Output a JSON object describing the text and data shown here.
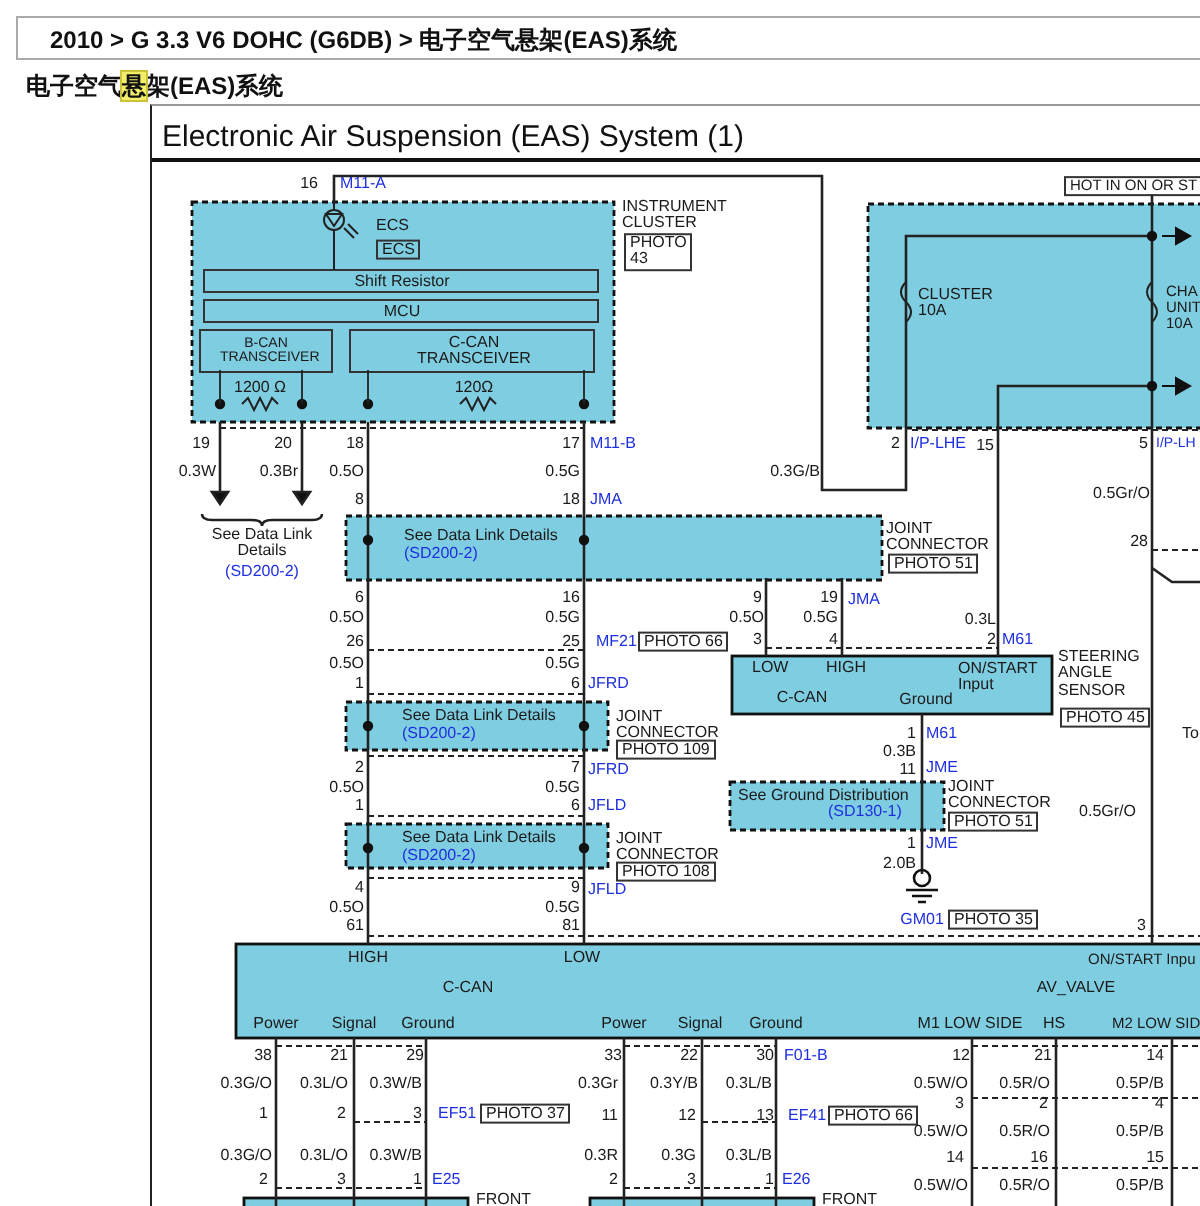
{
  "breadcrumb": "2010 > G 3.3 V6 DOHC (G6DB) > 电子空气悬架(EAS)系统",
  "heading": {
    "before": "电子空气",
    "highlighted": "悬",
    "after": "架(EAS)系统"
  },
  "diagram": {
    "title": "Electronic Air Suspension (EAS) System (1)",
    "labels": [
      {
        "text": "16",
        "kind": "pin"
      },
      {
        "text": "M11-A",
        "kind": "conn"
      },
      {
        "text": "ECS",
        "kind": "label"
      },
      {
        "text": "ECS",
        "kind": "tag"
      },
      {
        "text": "INSTRUMENT CLUSTER",
        "kind": "label"
      },
      {
        "text": "PHOTO 43",
        "kind": "photo"
      },
      {
        "text": "Shift Resistor",
        "kind": "bar"
      },
      {
        "text": "MCU",
        "kind": "bar"
      },
      {
        "text": "B-CAN TRANSCEIVER",
        "kind": "bar"
      },
      {
        "text": "C-CAN TRANSCEIVER",
        "kind": "bar"
      },
      {
        "text": "1200 Ω",
        "kind": "label"
      },
      {
        "text": "120Ω",
        "kind": "label"
      },
      {
        "text": "19",
        "kind": "pin"
      },
      {
        "text": "20",
        "kind": "pin"
      },
      {
        "text": "18",
        "kind": "pin"
      },
      {
        "text": "17",
        "kind": "pin"
      },
      {
        "text": "M11-B",
        "kind": "conn"
      },
      {
        "text": "0.3W",
        "kind": "wire"
      },
      {
        "text": "0.3Br",
        "kind": "wire"
      },
      {
        "text": "0.5O",
        "kind": "wire"
      },
      {
        "text": "0.5G",
        "kind": "wire"
      },
      {
        "text": "0.3G/B",
        "kind": "wire"
      },
      {
        "text": "8",
        "kind": "pin"
      },
      {
        "text": "18",
        "kind": "pin"
      },
      {
        "text": "JMA",
        "kind": "conn"
      },
      {
        "text": "See Data Link Details",
        "kind": "label"
      },
      {
        "text": "(SD200-2)",
        "kind": "link"
      },
      {
        "text": "See Data Link Details",
        "kind": "label"
      },
      {
        "text": "(SD200-2)",
        "kind": "link"
      },
      {
        "text": "JOINT CONNECTOR",
        "kind": "label"
      },
      {
        "text": "PHOTO 51",
        "kind": "photo"
      },
      {
        "text": "HOT IN ON OR ST",
        "kind": "tag"
      },
      {
        "text": "CLUSTER 10A",
        "kind": "label"
      },
      {
        "text": "CHA UNIT 10A",
        "kind": "label"
      },
      {
        "text": "2",
        "kind": "pin"
      },
      {
        "text": "I/P-LHE",
        "kind": "conn"
      },
      {
        "text": "15",
        "kind": "pin"
      },
      {
        "text": "5",
        "kind": "pin"
      },
      {
        "text": "I/P-LH",
        "kind": "conn"
      },
      {
        "text": "0.5Gr/O",
        "kind": "wire"
      },
      {
        "text": "28",
        "kind": "pin"
      },
      {
        "text": "6",
        "kind": "pin"
      },
      {
        "text": "16",
        "kind": "pin"
      },
      {
        "text": "9",
        "kind": "pin"
      },
      {
        "text": "19",
        "kind": "pin"
      },
      {
        "text": "JMA",
        "kind": "conn"
      },
      {
        "text": "0.5O",
        "kind": "wire"
      },
      {
        "text": "0.5G",
        "kind": "wire"
      },
      {
        "text": "0.5O",
        "kind": "wire"
      },
      {
        "text": "0.5G",
        "kind": "wire"
      },
      {
        "text": "0.3L",
        "kind": "wire"
      },
      {
        "text": "26",
        "kind": "pin"
      },
      {
        "text": "25",
        "kind": "pin"
      },
      {
        "text": "MF21",
        "kind": "conn"
      },
      {
        "text": "PHOTO 66",
        "kind": "photo"
      },
      {
        "text": "3",
        "kind": "pin"
      },
      {
        "text": "4",
        "kind": "pin"
      },
      {
        "text": "2",
        "kind": "pin"
      },
      {
        "text": "M61",
        "kind": "conn"
      },
      {
        "text": "0.5O",
        "kind": "wire"
      },
      {
        "text": "0.5G",
        "kind": "wire"
      },
      {
        "text": "1",
        "kind": "pin"
      },
      {
        "text": "6",
        "kind": "pin"
      },
      {
        "text": "JFRD",
        "kind": "conn"
      },
      {
        "text": "LOW",
        "kind": "label"
      },
      {
        "text": "HIGH",
        "kind": "label"
      },
      {
        "text": "C-CAN",
        "kind": "label"
      },
      {
        "text": "ON/START Input",
        "kind": "label"
      },
      {
        "text": "Ground",
        "kind": "label"
      },
      {
        "text": "See Data Link Details",
        "kind": "label"
      },
      {
        "text": "(SD200-2)",
        "kind": "link"
      },
      {
        "text": "JOINT CONNECTOR",
        "kind": "label"
      },
      {
        "text": "PHOTO 109",
        "kind": "photo"
      },
      {
        "text": "STEERING ANGLE SENSOR",
        "kind": "label"
      },
      {
        "text": "PHOTO 45",
        "kind": "photo"
      },
      {
        "text": "1",
        "kind": "pin"
      },
      {
        "text": "M61",
        "kind": "conn"
      },
      {
        "text": "0.3B",
        "kind": "wire"
      },
      {
        "text": "11",
        "kind": "pin"
      },
      {
        "text": "JME",
        "kind": "conn"
      },
      {
        "text": "To",
        "kind": "label"
      },
      {
        "text": "2",
        "kind": "pin"
      },
      {
        "text": "7",
        "kind": "pin"
      },
      {
        "text": "JFRD",
        "kind": "conn"
      },
      {
        "text": "0.5O",
        "kind": "wire"
      },
      {
        "text": "0.5G",
        "kind": "wire"
      },
      {
        "text": "See Ground Distribution",
        "kind": "label"
      },
      {
        "text": "(SD130-1)",
        "kind": "link"
      },
      {
        "text": "JOINT CONNECTOR",
        "kind": "label"
      },
      {
        "text": "PHOTO 51",
        "kind": "photo"
      },
      {
        "text": "0.5Gr/O",
        "kind": "wire"
      },
      {
        "text": "1",
        "kind": "pin"
      },
      {
        "text": "6",
        "kind": "pin"
      },
      {
        "text": "JFLD",
        "kind": "conn"
      },
      {
        "text": "See Data Link Details",
        "kind": "label"
      },
      {
        "text": "(SD200-2)",
        "kind": "link"
      },
      {
        "text": "JOINT CONNECTOR",
        "kind": "label"
      },
      {
        "text": "PHOTO 108",
        "kind": "photo"
      },
      {
        "text": "1",
        "kind": "pin"
      },
      {
        "text": "JME",
        "kind": "conn"
      },
      {
        "text": "2.0B",
        "kind": "wire"
      },
      {
        "text": "4",
        "kind": "pin"
      },
      {
        "text": "9",
        "kind": "pin"
      },
      {
        "text": "JFLD",
        "kind": "conn"
      },
      {
        "text": "0.5O",
        "kind": "wire"
      },
      {
        "text": "0.5G",
        "kind": "wire"
      },
      {
        "text": "61",
        "kind": "pin"
      },
      {
        "text": "81",
        "kind": "pin"
      },
      {
        "text": "GM01",
        "kind": "conn"
      },
      {
        "text": "PHOTO 35",
        "kind": "photo"
      },
      {
        "text": "3",
        "kind": "pin"
      },
      {
        "text": "HIGH",
        "kind": "label"
      },
      {
        "text": "LOW",
        "kind": "label"
      },
      {
        "text": "C-CAN",
        "kind": "label"
      },
      {
        "text": "ON/START Inpu",
        "kind": "label"
      },
      {
        "text": "AV_VALVE",
        "kind": "label"
      },
      {
        "text": "Power",
        "kind": "label"
      },
      {
        "text": "Signal",
        "kind": "label"
      },
      {
        "text": "Ground",
        "kind": "label"
      },
      {
        "text": "Power",
        "kind": "label"
      },
      {
        "text": "Signal",
        "kind": "label"
      },
      {
        "text": "Ground",
        "kind": "label"
      },
      {
        "text": "M1 LOW SIDE",
        "kind": "label"
      },
      {
        "text": "HS",
        "kind": "label"
      },
      {
        "text": "M2 LOW SID",
        "kind": "label"
      },
      {
        "text": "38",
        "kind": "pin"
      },
      {
        "text": "21",
        "kind": "pin"
      },
      {
        "text": "29",
        "kind": "pin"
      },
      {
        "text": "33",
        "kind": "pin"
      },
      {
        "text": "22",
        "kind": "pin"
      },
      {
        "text": "30",
        "kind": "pin"
      },
      {
        "text": "F01-B",
        "kind": "conn"
      },
      {
        "text": "12",
        "kind": "pin"
      },
      {
        "text": "21",
        "kind": "pin"
      },
      {
        "text": "14",
        "kind": "pin"
      },
      {
        "text": "0.3G/O",
        "kind": "wire"
      },
      {
        "text": "0.3L/O",
        "kind": "wire"
      },
      {
        "text": "0.3W/B",
        "kind": "wire"
      },
      {
        "text": "0.3Gr",
        "kind": "wire"
      },
      {
        "text": "0.3Y/B",
        "kind": "wire"
      },
      {
        "text": "0.3L/B",
        "kind": "wire"
      },
      {
        "text": "0.5W/O",
        "kind": "wire"
      },
      {
        "text": "0.5R/O",
        "kind": "wire"
      },
      {
        "text": "0.5P/B",
        "kind": "wire"
      },
      {
        "text": "1",
        "kind": "pin"
      },
      {
        "text": "2",
        "kind": "pin"
      },
      {
        "text": "3",
        "kind": "pin"
      },
      {
        "text": "EF51",
        "kind": "conn"
      },
      {
        "text": "PHOTO 37",
        "kind": "photo"
      },
      {
        "text": "11",
        "kind": "pin"
      },
      {
        "text": "12",
        "kind": "pin"
      },
      {
        "text": "13",
        "kind": "pin"
      },
      {
        "text": "EF41",
        "kind": "conn"
      },
      {
        "text": "PHOTO 66",
        "kind": "photo"
      },
      {
        "text": "3",
        "kind": "pin"
      },
      {
        "text": "2",
        "kind": "pin"
      },
      {
        "text": "4",
        "kind": "pin"
      },
      {
        "text": "0.5W/O",
        "kind": "wire"
      },
      {
        "text": "0.5R/O",
        "kind": "wire"
      },
      {
        "text": "0.5P/B",
        "kind": "wire"
      },
      {
        "text": "0.3G/O",
        "kind": "wire"
      },
      {
        "text": "0.3L/O",
        "kind": "wire"
      },
      {
        "text": "0.3W/B",
        "kind": "wire"
      },
      {
        "text": "0.3R",
        "kind": "wire"
      },
      {
        "text": "0.3G",
        "kind": "wire"
      },
      {
        "text": "0.3L/B",
        "kind": "wire"
      },
      {
        "text": "14",
        "kind": "pin"
      },
      {
        "text": "16",
        "kind": "pin"
      },
      {
        "text": "15",
        "kind": "pin"
      },
      {
        "text": "2",
        "kind": "pin"
      },
      {
        "text": "3",
        "kind": "pin"
      },
      {
        "text": "1",
        "kind": "pin"
      },
      {
        "text": "E25",
        "kind": "conn"
      },
      {
        "text": "2",
        "kind": "pin"
      },
      {
        "text": "3",
        "kind": "pin"
      },
      {
        "text": "1",
        "kind": "pin"
      },
      {
        "text": "E26",
        "kind": "conn"
      },
      {
        "text": "0.5W/O",
        "kind": "wire"
      },
      {
        "text": "0.5R/O",
        "kind": "wire"
      },
      {
        "text": "0.5P/B",
        "kind": "wire"
      },
      {
        "text": "FRONT",
        "kind": "label"
      },
      {
        "text": "FRONT",
        "kind": "label"
      }
    ]
  }
}
